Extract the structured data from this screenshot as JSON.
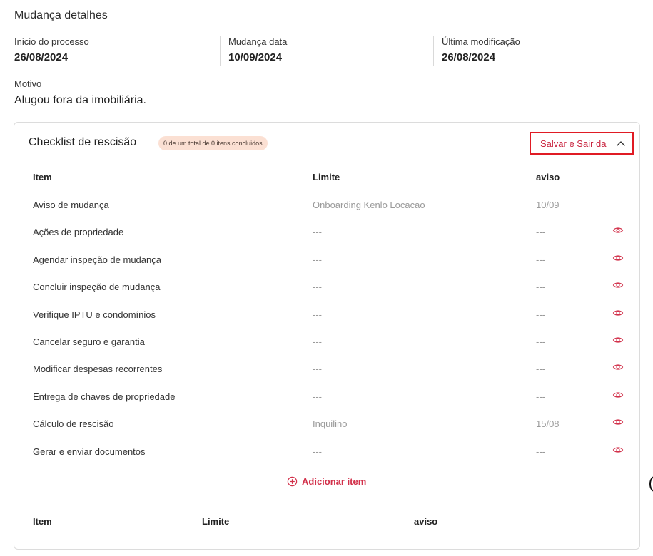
{
  "details": {
    "title": "Mudança detalhes",
    "inicio_label": "Inicio do processo",
    "inicio_value": "26/08/2024",
    "mudanca_label": "Mudança data",
    "mudanca_value": "10/09/2024",
    "ultima_label": "Última modificação",
    "ultima_value": "26/08/2024",
    "motivo_label": "Motivo",
    "motivo_value": "Alugou fora da imobiliária."
  },
  "checklist": {
    "title": "Checklist de rescisão",
    "badge": "0 de um total de 0 itens concluidos",
    "save_label": "Salvar e Sair da",
    "columns": {
      "item": "Item",
      "limite": "Limite",
      "aviso": "aviso"
    },
    "rows": [
      {
        "item": "Aviso de mudança",
        "limite": "Onboarding Kenlo Locacao",
        "aviso": "10/09",
        "eye": false
      },
      {
        "item": "Ações de propriedade",
        "limite": "---",
        "aviso": "---",
        "eye": true
      },
      {
        "item": "Agendar inspeção de mudança",
        "limite": "---",
        "aviso": "---",
        "eye": true
      },
      {
        "item": "Concluir inspeção de mudança",
        "limite": "---",
        "aviso": "---",
        "eye": true
      },
      {
        "item": "Verifique IPTU e condomínios",
        "limite": "---",
        "aviso": "---",
        "eye": true
      },
      {
        "item": "Cancelar seguro e garantia",
        "limite": "---",
        "aviso": "---",
        "eye": true
      },
      {
        "item": "Modificar despesas recorrentes",
        "limite": "---",
        "aviso": "---",
        "eye": true
      },
      {
        "item": "Entrega de chaves de propriedade",
        "limite": "---",
        "aviso": "---",
        "eye": true
      },
      {
        "item": "Cálculo de rescisão",
        "limite": "Inquilino",
        "aviso": "15/08",
        "eye": true
      },
      {
        "item": "Gerar e enviar documentos",
        "limite": "---",
        "aviso": "---",
        "eye": true
      }
    ],
    "add_item_label": "Adicionar item",
    "footer_columns": {
      "item": "Item",
      "limite": "Limite",
      "aviso": "aviso"
    }
  },
  "icons": {
    "eye": "eye-icon",
    "chevron": "chevron-up-icon",
    "add": "plus-circle-icon"
  },
  "colors": {
    "accent": "#d2304a",
    "highlight_border": "#e01b24",
    "badge_bg": "#fbe0d3"
  }
}
